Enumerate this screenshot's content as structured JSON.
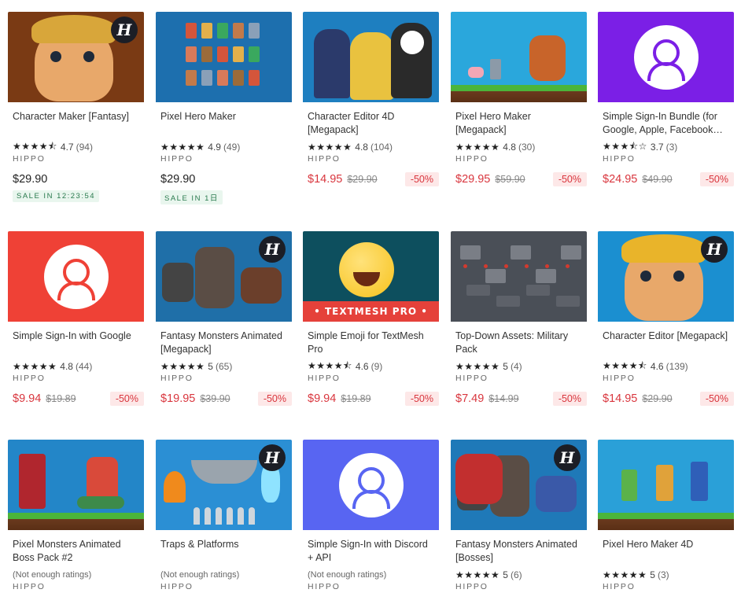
{
  "products": [
    {
      "title": "Character Maker [Fantasy]",
      "stars": "★★★★⯪",
      "rating": "4.7",
      "count": "(94)",
      "publisher": "HIPPO",
      "price": "$29.90",
      "orig": "",
      "discount": "",
      "badge": "SALE IN 12:23:54",
      "sale": false,
      "thumb": "char-maker-fantasy",
      "bg": "#7a3a14",
      "hbadge": true
    },
    {
      "title": "Pixel Hero Maker",
      "stars": "★★★★★",
      "rating": "4.9",
      "count": "(49)",
      "publisher": "HIPPO",
      "price": "$29.90",
      "orig": "",
      "discount": "",
      "badge": "SALE IN 1日",
      "sale": false,
      "thumb": "pixel-hero-maker",
      "bg": "#1d6fae",
      "hbadge": false
    },
    {
      "title": "Character Editor 4D [Megapack]",
      "stars": "★★★★★",
      "rating": "4.8",
      "count": "(104)",
      "publisher": "HIPPO",
      "price": "$14.95",
      "orig": "$29.90",
      "discount": "-50%",
      "badge": "",
      "sale": true,
      "thumb": "char-editor-4d",
      "bg": "#1e7fc0",
      "hbadge": false
    },
    {
      "title": "Pixel Hero Maker [Megapack]",
      "stars": "★★★★★",
      "rating": "4.8",
      "count": "(30)",
      "publisher": "HIPPO",
      "price": "$29.95",
      "orig": "$59.90",
      "discount": "-50%",
      "badge": "",
      "sale": true,
      "thumb": "pixel-hero-megapack",
      "bg": "#2aa7dc",
      "hbadge": false
    },
    {
      "title": "Simple Sign-In Bundle (for Google, Apple, Facebook…",
      "stars": "★★★⯪☆",
      "rating": "3.7",
      "count": "(3)",
      "publisher": "HIPPO",
      "price": "$24.95",
      "orig": "$49.90",
      "discount": "-50%",
      "badge": "",
      "sale": true,
      "thumb": "signin-bundle",
      "bg": "#7b1fe6",
      "hbadge": false
    },
    {
      "title": "Simple Sign-In with Google",
      "stars": "★★★★★",
      "rating": "4.8",
      "count": "(44)",
      "publisher": "HIPPO",
      "price": "$9.94",
      "orig": "$19.89",
      "discount": "-50%",
      "badge": "",
      "sale": true,
      "thumb": "signin-google",
      "bg": "#ef4136",
      "hbadge": false
    },
    {
      "title": "Fantasy Monsters Animated [Megapack]",
      "stars": "★★★★★",
      "rating": "5",
      "count": "(65)",
      "publisher": "HIPPO",
      "price": "$19.95",
      "orig": "$39.90",
      "discount": "-50%",
      "badge": "",
      "sale": true,
      "thumb": "fantasy-monsters",
      "bg": "#1f6fa8",
      "hbadge": true
    },
    {
      "title": "Simple Emoji for TextMesh Pro",
      "stars": "★★★★⯪",
      "rating": "4.6",
      "count": "(9)",
      "publisher": "HIPPO",
      "price": "$9.94",
      "orig": "$19.89",
      "discount": "-50%",
      "badge": "",
      "sale": true,
      "thumb": "emoji-textmesh",
      "bg": "#0d4f5e",
      "hbadge": false,
      "banner": "• TEXTMESH PRO •"
    },
    {
      "title": "Top-Down Assets: Military Pack",
      "stars": "★★★★★",
      "rating": "5",
      "count": "(4)",
      "publisher": "HIPPO",
      "price": "$7.49",
      "orig": "$14.99",
      "discount": "-50%",
      "badge": "",
      "sale": true,
      "thumb": "military-pack",
      "bg": "#4a4f57",
      "hbadge": false
    },
    {
      "title": "Character Editor [Megapack]",
      "stars": "★★★★⯪",
      "rating": "4.6",
      "count": "(139)",
      "publisher": "HIPPO",
      "price": "$14.95",
      "orig": "$29.90",
      "discount": "-50%",
      "badge": "",
      "sale": true,
      "thumb": "char-editor-megapack",
      "bg": "#1b8fd0",
      "hbadge": true
    },
    {
      "title": "Pixel Monsters Animated Boss Pack #2",
      "stars": "",
      "rating": "(Not enough ratings)",
      "count": "",
      "publisher": "HIPPO",
      "price": "",
      "orig": "",
      "discount": "",
      "badge": "",
      "sale": false,
      "thumb": "pixel-monsters-boss",
      "bg": "#2386c8",
      "hbadge": false
    },
    {
      "title": "Traps & Platforms",
      "stars": "",
      "rating": "(Not enough ratings)",
      "count": "",
      "publisher": "HIPPO",
      "price": "",
      "orig": "",
      "discount": "",
      "badge": "",
      "sale": false,
      "thumb": "traps-platforms",
      "bg": "#2b8fd4",
      "hbadge": true
    },
    {
      "title": "Simple Sign-In with Discord + API",
      "stars": "",
      "rating": "(Not enough ratings)",
      "count": "",
      "publisher": "HIPPO",
      "price": "",
      "orig": "",
      "discount": "",
      "badge": "",
      "sale": false,
      "thumb": "signin-discord",
      "bg": "#5865f2",
      "hbadge": false
    },
    {
      "title": "Fantasy Monsters Animated [Bosses]",
      "stars": "★★★★★",
      "rating": "5",
      "count": "(6)",
      "publisher": "HIPPO",
      "price": "",
      "orig": "",
      "discount": "",
      "badge": "",
      "sale": false,
      "thumb": "fantasy-bosses",
      "bg": "#1f79b8",
      "hbadge": true
    },
    {
      "title": "Pixel Hero Maker 4D",
      "stars": "★★★★★",
      "rating": "5",
      "count": "(3)",
      "publisher": "HIPPO",
      "price": "",
      "orig": "",
      "discount": "",
      "badge": "",
      "sale": false,
      "thumb": "pixel-hero-4d",
      "bg": "#2aa0d8",
      "hbadge": false
    }
  ],
  "colors": {
    "sale_red": "#d9363e",
    "discount_bg": "#fde8e8",
    "sale_badge_bg": "#e9f6ee",
    "sale_badge_text": "#2a7a4e"
  }
}
